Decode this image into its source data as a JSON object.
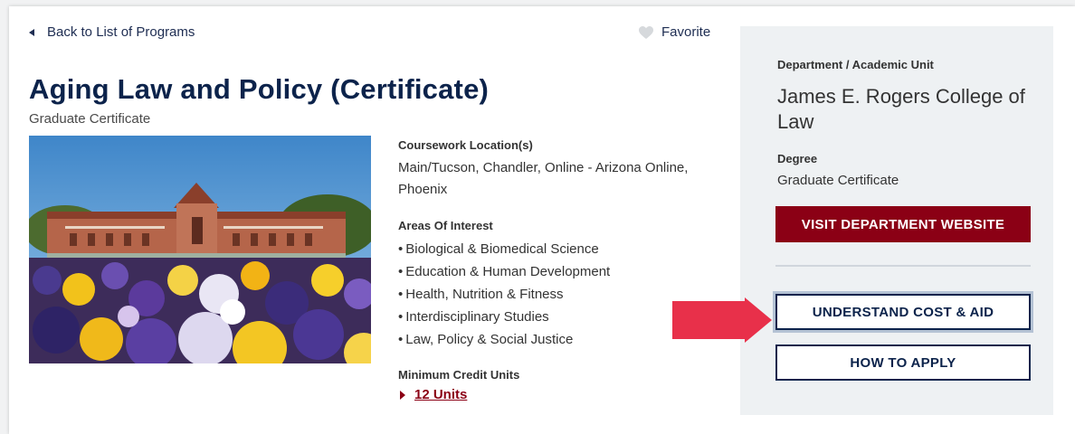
{
  "nav": {
    "back_label": "Back to List of Programs",
    "favorite_label": "Favorite"
  },
  "program": {
    "title": "Aging Law and Policy (Certificate)",
    "subtitle": "Graduate Certificate"
  },
  "details": {
    "coursework_label": "Coursework Location(s)",
    "coursework_value": "Main/Tucson, Chandler, Online - Arizona Online, Phoenix",
    "areas_label": "Areas Of Interest",
    "areas": [
      "Biological & Biomedical Science",
      "Education & Human Development",
      "Health, Nutrition & Fitness",
      "Interdisciplinary Studies",
      "Law, Policy & Social Justice"
    ],
    "credit_label": "Minimum Credit Units",
    "credit_value": "12 Units"
  },
  "sidebar": {
    "department_label": "Department / Academic Unit",
    "department_value": "James E. Rogers College of Law",
    "degree_label": "Degree",
    "degree_value": "Graduate Certificate",
    "visit_button": "VISIT DEPARTMENT WEBSITE",
    "cost_button": "UNDERSTAND COST & AID",
    "apply_button": "HOW TO APPLY"
  },
  "colors": {
    "navy": "#0c234b",
    "red": "#8b0015",
    "annotation_arrow": "#e8304a",
    "sidebar_bg": "#eef1f3"
  },
  "icons": [
    "triangle-left-icon",
    "heart-icon",
    "triangle-right-icon"
  ]
}
